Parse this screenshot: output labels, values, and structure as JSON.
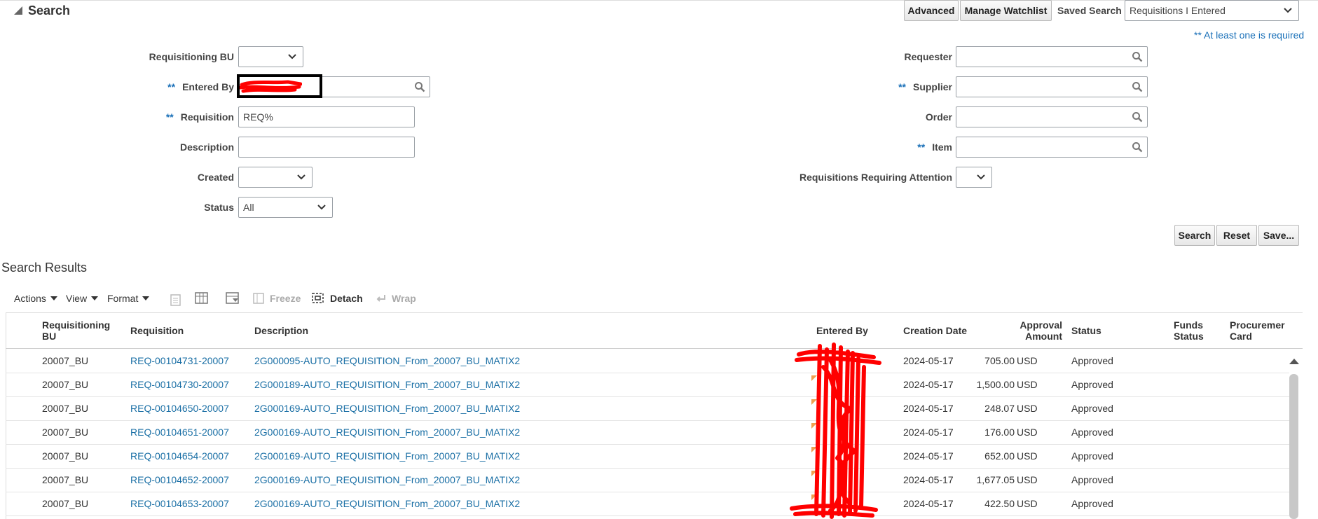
{
  "search": {
    "title": "Search",
    "advanced_label": "Advanced",
    "manage_watchlist_label": "Manage Watchlist",
    "saved_search_label": "Saved Search",
    "saved_search_value": "Requisitions I Entered",
    "required_note": "** At least one is required",
    "required_marker": "**",
    "fields": {
      "requisitioning_bu": {
        "label": "Requisitioning BU",
        "value": ""
      },
      "entered_by": {
        "label": "Entered By",
        "value": ""
      },
      "requisition": {
        "label": "Requisition",
        "value": "REQ%"
      },
      "description": {
        "label": "Description",
        "value": ""
      },
      "created": {
        "label": "Created",
        "value": ""
      },
      "status": {
        "label": "Status",
        "value": "All"
      },
      "requester": {
        "label": "Requester",
        "value": ""
      },
      "supplier": {
        "label": "Supplier",
        "value": ""
      },
      "order": {
        "label": "Order",
        "value": ""
      },
      "item": {
        "label": "Item",
        "value": ""
      },
      "requiring_attention": {
        "label": "Requisitions Requiring Attention",
        "value": ""
      }
    },
    "buttons": {
      "search": "Search",
      "reset": "Reset",
      "save": "Save..."
    }
  },
  "results": {
    "title": "Search Results",
    "toolbar": {
      "actions": "Actions",
      "view": "View",
      "format": "Format",
      "freeze": "Freeze",
      "detach": "Detach",
      "wrap": "Wrap"
    },
    "columns": {
      "bu": "Requisitioning BU",
      "requisition": "Requisition",
      "description": "Description",
      "entered_by": "Entered By",
      "creation_date": "Creation Date",
      "approval_amount": "Approval Amount",
      "status": "Status",
      "funds_status": "Funds Status",
      "procurement_card": "Procuremer Card"
    },
    "rows": [
      {
        "bu": "20007_BU",
        "requisition": "REQ-00104731-20007",
        "description": "2G000095-AUTO_REQUISITION_From_20007_BU_MATIX2",
        "date": "2024-05-17",
        "amount": "705.00",
        "currency": "USD",
        "status": "Approved"
      },
      {
        "bu": "20007_BU",
        "requisition": "REQ-00104730-20007",
        "description": "2G000189-AUTO_REQUISITION_From_20007_BU_MATIX2",
        "date": "2024-05-17",
        "amount": "1,500.00",
        "currency": "USD",
        "status": "Approved"
      },
      {
        "bu": "20007_BU",
        "requisition": "REQ-00104650-20007",
        "description": "2G000169-AUTO_REQUISITION_From_20007_BU_MATIX2",
        "date": "2024-05-17",
        "amount": "248.07",
        "currency": "USD",
        "status": "Approved"
      },
      {
        "bu": "20007_BU",
        "requisition": "REQ-00104651-20007",
        "description": "2G000169-AUTO_REQUISITION_From_20007_BU_MATIX2",
        "date": "2024-05-17",
        "amount": "176.00",
        "currency": "USD",
        "status": "Approved"
      },
      {
        "bu": "20007_BU",
        "requisition": "REQ-00104654-20007",
        "description": "2G000169-AUTO_REQUISITION_From_20007_BU_MATIX2",
        "date": "2024-05-17",
        "amount": "652.00",
        "currency": "USD",
        "status": "Approved"
      },
      {
        "bu": "20007_BU",
        "requisition": "REQ-00104652-20007",
        "description": "2G000169-AUTO_REQUISITION_From_20007_BU_MATIX2",
        "date": "2024-05-17",
        "amount": "1,677.05",
        "currency": "USD",
        "status": "Approved"
      },
      {
        "bu": "20007_BU",
        "requisition": "REQ-00104653-20007",
        "description": "2G000169-AUTO_REQUISITION_From_20007_BU_MATIX2",
        "date": "2024-05-17",
        "amount": "422.50",
        "currency": "USD",
        "status": "Approved"
      }
    ]
  },
  "colors": {
    "link": "#1a6fa5",
    "required": "#1a70b8",
    "redaction": "#ff0000",
    "highlight_box": "#000000"
  }
}
